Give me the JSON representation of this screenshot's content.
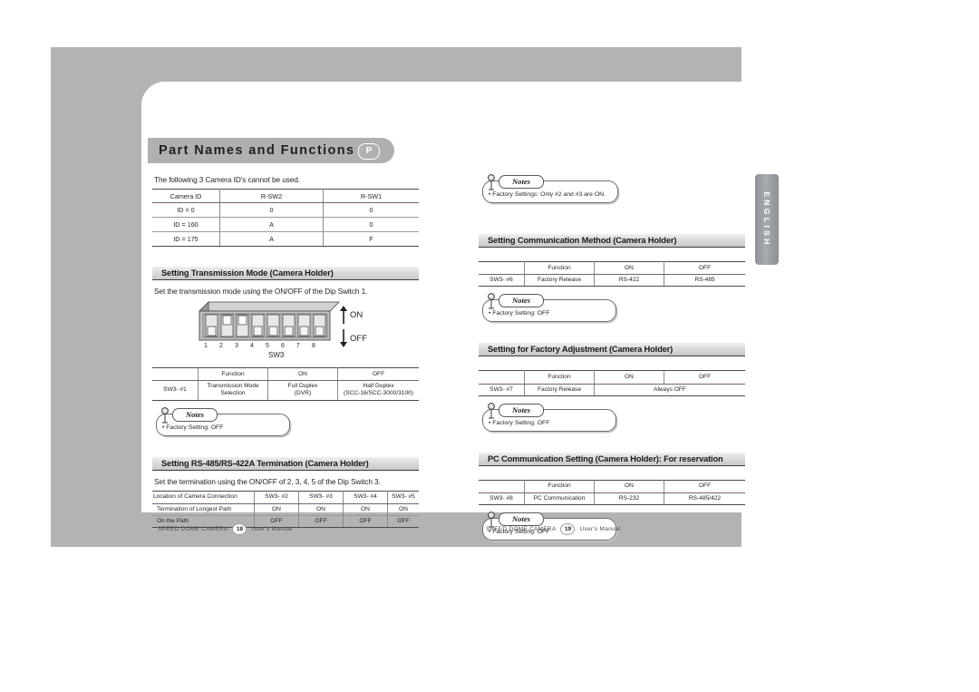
{
  "document": {
    "title": "Part Names and Functions",
    "title_badge": "P",
    "side_tab": "ENGLISH"
  },
  "left_page": {
    "intro_text": "The following 3 Camera ID's cannot be used.",
    "camera_id_table": {
      "headers": [
        "Camera ID",
        "R-SW2",
        "R-SW1"
      ],
      "rows": [
        [
          "ID = 0",
          "0",
          "0"
        ],
        [
          "ID = 160",
          "A",
          "0"
        ],
        [
          "ID = 175",
          "A",
          "F"
        ]
      ]
    },
    "transmission_section": {
      "heading": "Setting Transmission Mode (Camera Holder)",
      "instruction": "Set the transmission mode using the ON/OFF of the Dip Switch 1.",
      "diagram": {
        "switch_label": "SW3",
        "on_label": "ON",
        "off_label": "OFF",
        "switch_numbers": [
          "1",
          "2",
          "3",
          "4",
          "5",
          "6",
          "7",
          "8"
        ],
        "switch_states": [
          "OFF",
          "ON",
          "ON",
          "OFF",
          "OFF",
          "OFF",
          "OFF",
          "OFF"
        ]
      },
      "table": {
        "headers": [
          "",
          "Function",
          "ON",
          "OFF"
        ],
        "rows": [
          [
            "SW3- #1",
            "Transmission Mode\nSelection",
            "Full Duplex\n(DVR)",
            "Half Duplex\n(SCC-16/SCC-3000/3100)"
          ]
        ]
      },
      "note": {
        "tag": "Notes",
        "text": "• Factory Setting: OFF"
      }
    },
    "termination_section": {
      "heading": "Setting RS-485/RS-422A Termination (Camera Holder)",
      "instruction": "Set the termination using the ON/OFF of 2, 3, 4, 5 of the Dip Switch 3.",
      "table": {
        "headers": [
          "Location of Camera Connection",
          "SW3- #2",
          "SW3- #3",
          "SW3- #4",
          "SW3- #5"
        ],
        "rows": [
          [
            "Termination of Longest Path",
            "ON",
            "ON",
            "ON",
            "ON"
          ],
          [
            "On the Path",
            "OFF",
            "OFF",
            "OFF",
            "OFF"
          ]
        ]
      }
    },
    "footer": {
      "brand": "SPEED DOME CAMERA",
      "page": "18",
      "manual": "User's Manual"
    }
  },
  "right_page": {
    "top_note": {
      "tag": "Notes",
      "text": "• Factory Settings: Only #2 and #3 are ON."
    },
    "communication_section": {
      "heading": "Setting Communication Method (Camera Holder)",
      "table": {
        "headers": [
          "",
          "Function",
          "ON",
          "OFF"
        ],
        "rows": [
          [
            "SW3- #6",
            "Factory Release",
            "RS-422",
            "RS-485"
          ]
        ]
      },
      "note": {
        "tag": "Notes",
        "text": "• Factory Setting: OFF"
      }
    },
    "factory_section": {
      "heading": "Setting for Factory Adjustment (Camera Holder)",
      "table": {
        "headers": [
          "",
          "Function",
          "ON",
          "OFF"
        ],
        "rows": [
          [
            "SW3- #7",
            "Factory Release",
            "Always OFF"
          ]
        ]
      },
      "note": {
        "tag": "Notes",
        "text": "• Factory Setting: OFF"
      }
    },
    "pc_section": {
      "heading": "PC Communication Setting (Camera Holder): For reservation",
      "table": {
        "headers": [
          "",
          "Function",
          "ON",
          "OFF"
        ],
        "rows": [
          [
            "SW3- #8",
            "PC Communication",
            "RS-232",
            "RS-485/422"
          ]
        ]
      },
      "note": {
        "tag": "Notes",
        "text": "• Factory Setting: OFF"
      }
    },
    "footer": {
      "brand": "SPEED DOME CAMERA",
      "page": "19",
      "manual": "User's Manual"
    }
  }
}
